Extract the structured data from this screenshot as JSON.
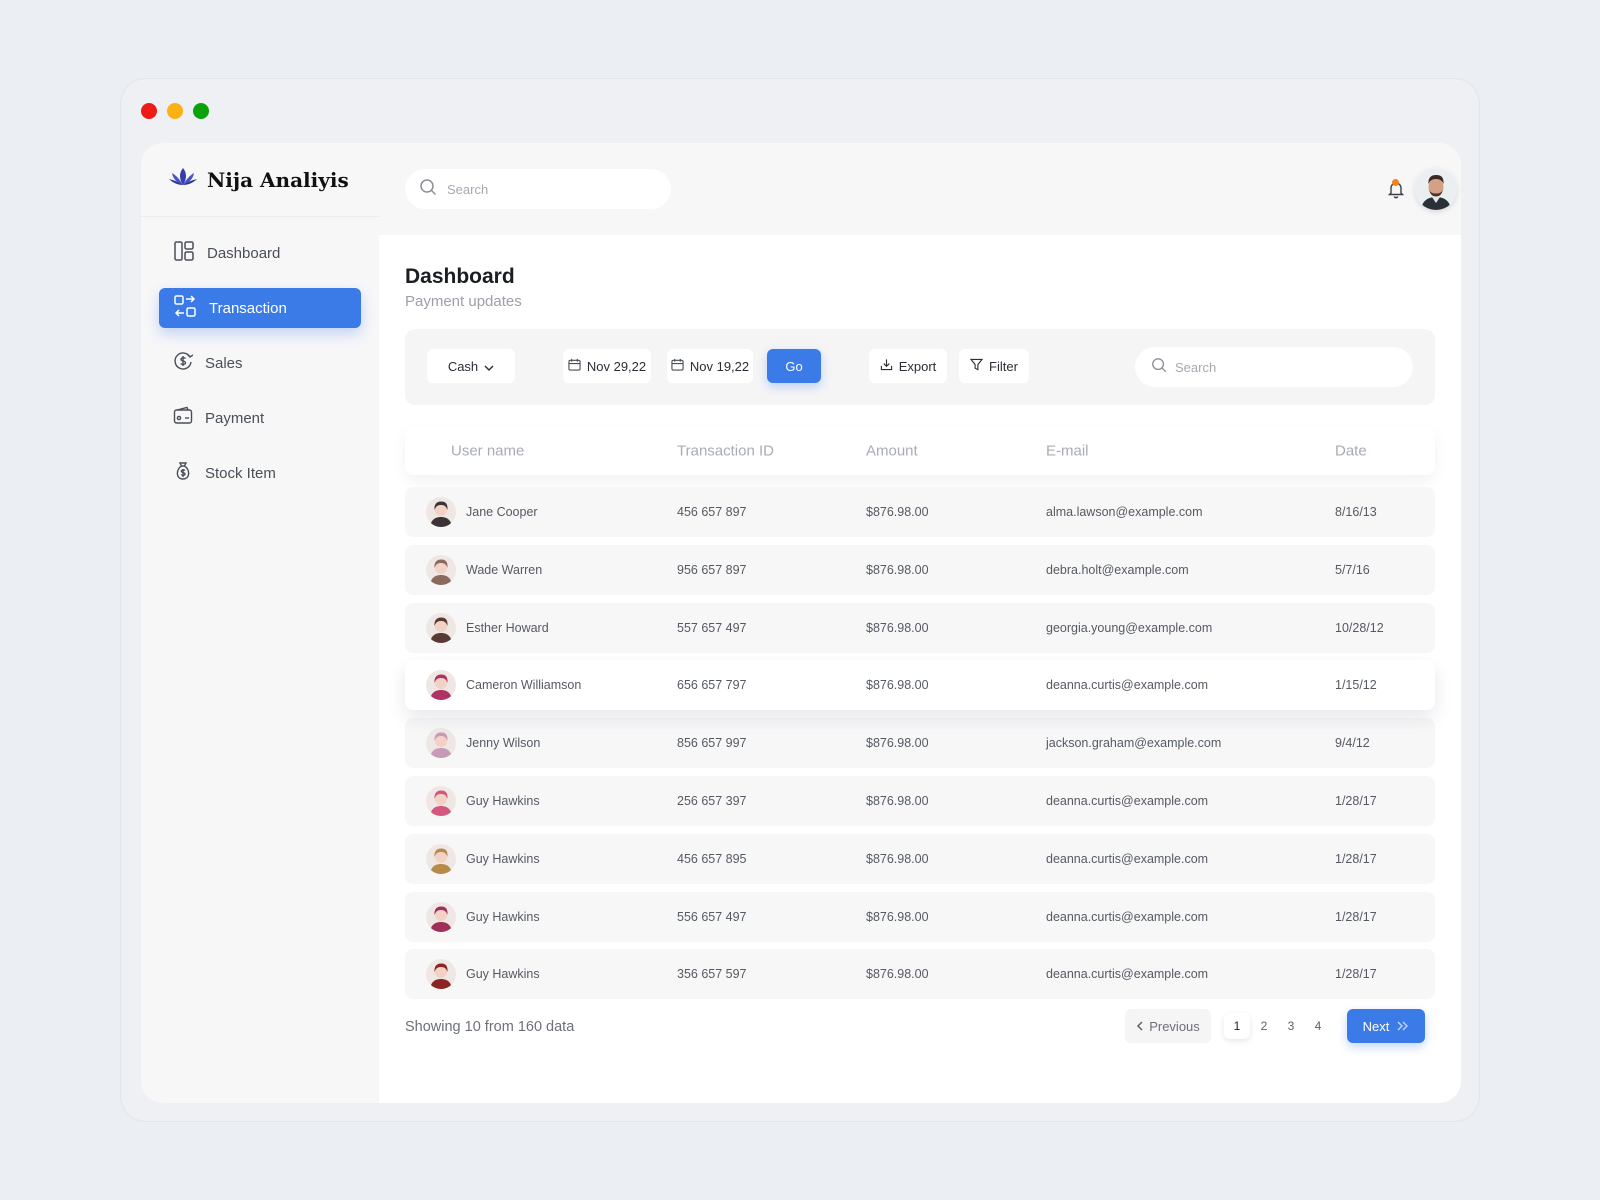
{
  "window_controls": [
    {
      "name": "close",
      "color": "#ed1c16"
    },
    {
      "name": "minimize",
      "color": "#fbb013"
    },
    {
      "name": "maximize",
      "color": "#0ca30a"
    }
  ],
  "brand": {
    "name": "Nija Analiyis",
    "logo_icon": "lotus-icon",
    "accent": "#3b7be8"
  },
  "sidebar": {
    "items": [
      {
        "label": "Dashboard",
        "icon": "dashboard-icon",
        "active": false
      },
      {
        "label": "Transaction",
        "icon": "transaction-icon",
        "active": true
      },
      {
        "label": "Sales",
        "icon": "sales-icon",
        "active": false
      },
      {
        "label": "Payment",
        "icon": "payment-icon",
        "active": false
      },
      {
        "label": "Stock Item",
        "icon": "stock-item-icon",
        "active": false
      }
    ]
  },
  "topbar": {
    "search_placeholder": "Search",
    "notification_icon": "bell-icon",
    "notification_dot_color": "#f5821f"
  },
  "page": {
    "title": "Dashboard",
    "subtitle": "Payment updates"
  },
  "toolbar": {
    "method": "Cash",
    "date_from": "Nov 29,22",
    "date_to": "Nov 19,22",
    "go_label": "Go",
    "export_label": "Export",
    "filter_label": "Filter",
    "search_placeholder": "Search"
  },
  "table": {
    "headers": {
      "user": "User name",
      "txid": "Transaction ID",
      "amount": "Amount",
      "email": "E-mail",
      "date": "Date"
    },
    "rows": [
      {
        "user": "Jane Cooper",
        "txid": "456 657 897",
        "amount": "$876.98.00",
        "email": "alma.lawson@example.com",
        "date": "8/16/13",
        "avatar_color": "#3d3336"
      },
      {
        "user": "Wade Warren",
        "txid": "956 657 897",
        "amount": "$876.98.00",
        "email": "debra.holt@example.com",
        "date": "5/7/16",
        "avatar_color": "#8a6a5c"
      },
      {
        "user": "Esther Howard",
        "txid": "557 657 497",
        "amount": "$876.98.00",
        "email": "georgia.young@example.com",
        "date": "10/28/12",
        "avatar_color": "#5a3b33"
      },
      {
        "user": "Cameron Williamson",
        "txid": "656 657 797",
        "amount": "$876.98.00",
        "email": "deanna.curtis@example.com",
        "date": "1/15/12",
        "avatar_color": "#b03366"
      },
      {
        "user": "Jenny Wilson",
        "txid": "856 657 997",
        "amount": "$876.98.00",
        "email": "jackson.graham@example.com",
        "date": "9/4/12",
        "avatar_color": "#c99ab8"
      },
      {
        "user": "Guy Hawkins",
        "txid": "256 657 397",
        "amount": "$876.98.00",
        "email": "deanna.curtis@example.com",
        "date": "1/28/17",
        "avatar_color": "#d6577e"
      },
      {
        "user": "Guy Hawkins",
        "txid": "456 657 895",
        "amount": "$876.98.00",
        "email": "deanna.curtis@example.com",
        "date": "1/28/17",
        "avatar_color": "#b88a4a"
      },
      {
        "user": "Guy Hawkins",
        "txid": "556 657 497",
        "amount": "$876.98.00",
        "email": "deanna.curtis@example.com",
        "date": "1/28/17",
        "avatar_color": "#a0305a"
      },
      {
        "user": "Guy Hawkins",
        "txid": "356 657 597",
        "amount": "$876.98.00",
        "email": "deanna.curtis@example.com",
        "date": "1/28/17",
        "avatar_color": "#8c2424"
      }
    ]
  },
  "footer": {
    "showing_text": "Showing 10 from 160 data",
    "prev_label": "Previous",
    "next_label": "Next",
    "pages": [
      "1",
      "2",
      "3",
      "4"
    ],
    "current_page": "1"
  }
}
